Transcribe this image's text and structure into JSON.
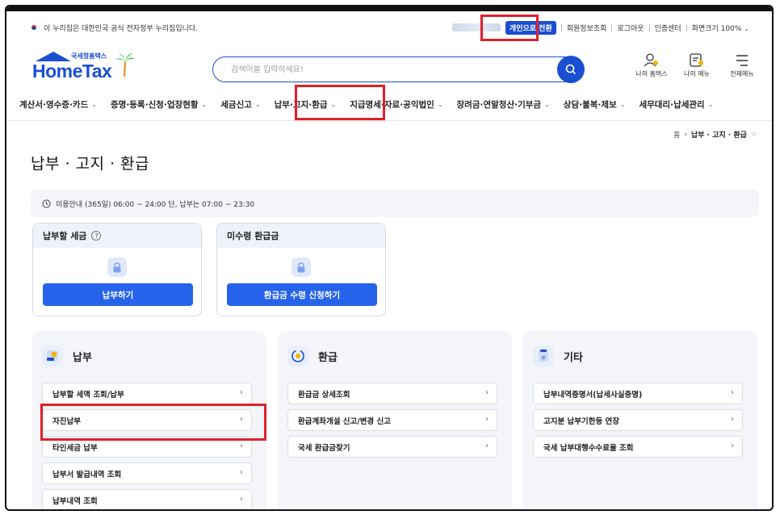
{
  "gov_banner": {
    "text": "이 누리집은 대한민국 공식 전자정부 누리집입니다.",
    "switch_label": "개인으로 전환",
    "links": [
      "회원정보조회",
      "로그아웃",
      "인증센터"
    ],
    "zoom_label": "화면크기",
    "zoom_value": "100%"
  },
  "header": {
    "logo_small": "국세청홈택스",
    "logo_name": "HomeTax",
    "search_placeholder": "검색어를 입력하세요!",
    "icons": [
      {
        "label": "나의 홈택스",
        "icon": "my-hometax-icon"
      },
      {
        "label": "나의 메뉴",
        "icon": "my-menu-icon"
      },
      {
        "label": "전체메뉴",
        "icon": "all-menu-icon"
      }
    ]
  },
  "gnb": {
    "items": [
      "계산서·영수증·카드",
      "증명·등록·신청·업장현황",
      "세금신고",
      "납부·고지·환급",
      "지급명세·자료·공익법인",
      "장려금·연말정산·기부금",
      "상담·불복·제보",
      "세무대리·납세관리"
    ]
  },
  "breadcrumb": {
    "home": "홈",
    "current": "납부 · 고지 · 환급"
  },
  "page": {
    "title": "납부 · 고지 · 환급",
    "notice": "이용안내 (365일) 06:00 ~ 24:00 단, 납부는 07:00 ~ 23:30"
  },
  "summary": [
    {
      "title": "납부할 세금",
      "button": "납부하기",
      "has_help": true
    },
    {
      "title": "미수령 환급금",
      "button": "환급금 수령 신청하기",
      "has_help": false
    }
  ],
  "panels": [
    {
      "title": "납부",
      "icon": "payment-icon",
      "items": [
        "납부할 세액 조회/납부",
        "자진납부",
        "타인세금 납부",
        "납부서 발급내역 조회",
        "납부내역 조회"
      ]
    },
    {
      "title": "환급",
      "icon": "refund-icon",
      "items": [
        "환급금 상세조회",
        "환급계좌개설 신고/변경 신고",
        "국세 환급금찾기"
      ]
    },
    {
      "title": "기타",
      "icon": "etc-icon",
      "items": [
        "납부내역증명서(납세사실증명)",
        "고지분 납부기한등 연장",
        "국세 납부대행수수료율 조회"
      ]
    }
  ],
  "colors": {
    "brand": "#1a4fd1",
    "button": "#2563eb",
    "highlight": "#e0202a",
    "panel_bg": "#f3f5f9"
  }
}
